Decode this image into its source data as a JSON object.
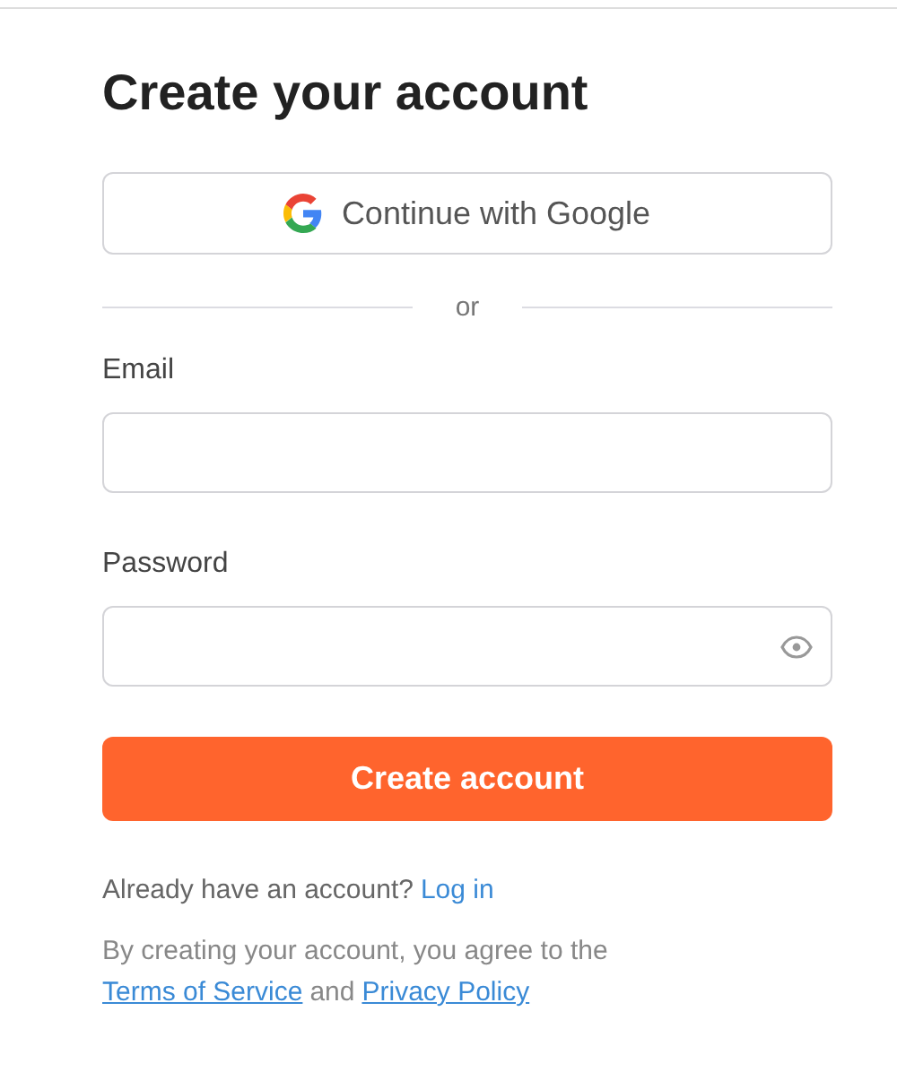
{
  "title": "Create your account",
  "google_button": {
    "label": "Continue with Google"
  },
  "divider": {
    "label": "or"
  },
  "fields": [
    {
      "label": "Email",
      "kind": "text"
    },
    {
      "label": "Password",
      "kind": "password"
    }
  ],
  "submit_button": {
    "label": "Create account"
  },
  "login_prompt": {
    "text": "Already have an account?",
    "link": "Log in"
  },
  "legal": {
    "text": "By creating your account, you agree to the",
    "terms_link": "Terms of Service",
    "joiner": "and",
    "privacy_link": "Privacy Policy"
  }
}
